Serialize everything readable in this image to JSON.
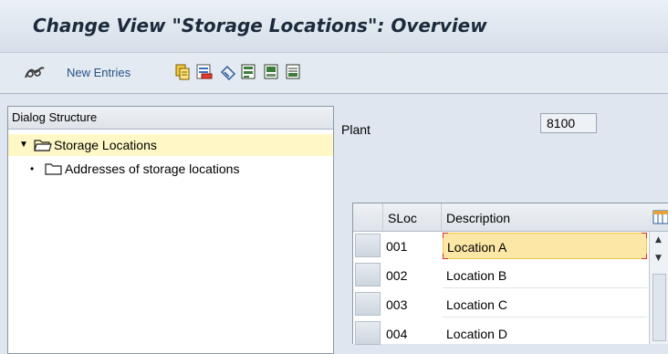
{
  "window": {
    "title": "Change View \"Storage Locations\": Overview"
  },
  "toolbar": {
    "new_entries_label": "New Entries",
    "icons": [
      "edit-glasses-icon",
      "copy-icon",
      "delete-icon",
      "undo-icon",
      "select-all-icon",
      "select-block-icon",
      "deselect-all-icon"
    ]
  },
  "dialog_structure": {
    "header": "Dialog Structure",
    "items": [
      {
        "label": "Storage Locations",
        "expanded": true,
        "selected": true
      },
      {
        "label": "Addresses of storage locations",
        "expanded": false,
        "selected": false
      }
    ]
  },
  "plant": {
    "label": "Plant",
    "value": "8100"
  },
  "table": {
    "columns": [
      "SLoc",
      "Description"
    ],
    "rows": [
      {
        "sloc": "001",
        "description": "Location A"
      },
      {
        "sloc": "002",
        "description": "Location B"
      },
      {
        "sloc": "003",
        "description": "Location C"
      },
      {
        "sloc": "004",
        "description": "Location D"
      }
    ]
  },
  "colors": {
    "title_text": "#1c2a3c",
    "link_blue": "#24528a",
    "selected_row": "#fff8c6",
    "active_cell": "#fde7a6",
    "focus_corner": "#d9302b"
  }
}
